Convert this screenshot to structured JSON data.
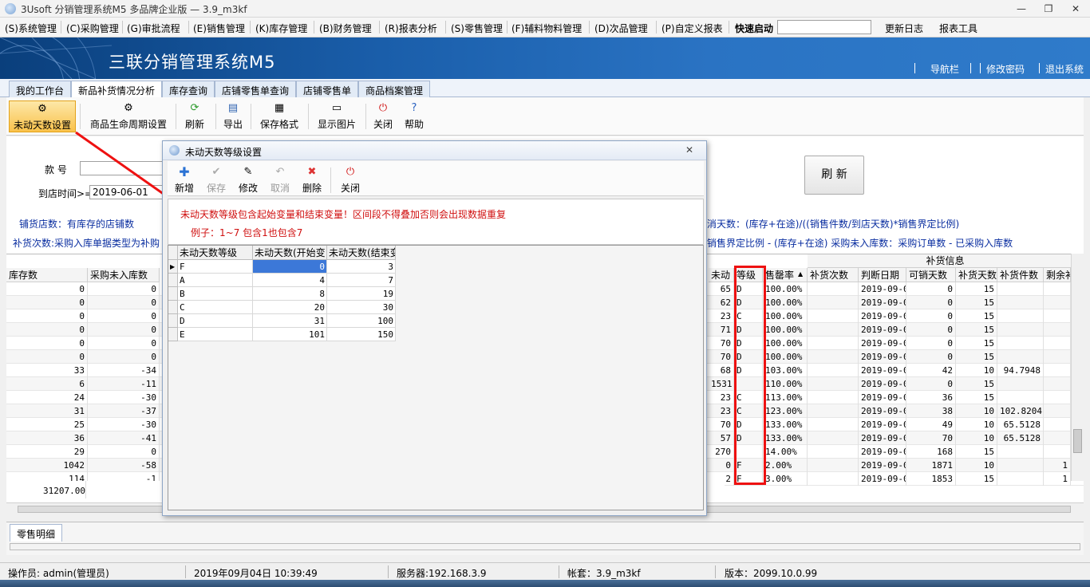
{
  "window": {
    "title": "3Usoft 分销管理系统M5 多品牌企业版 — 3.9_m3kf",
    "min": "—",
    "max": "❐",
    "close": "✕"
  },
  "menu": [
    "(S)系统管理",
    "(C)采购管理",
    "(G)审批流程",
    "(E)销售管理",
    "(K)库存管理",
    "(B)财务管理",
    "(R)报表分析",
    "(S)零售管理",
    "(F)辅料物料管理",
    "(D)次品管理",
    "(P)自定义报表",
    "快速启动",
    "更新日志",
    "报表工具"
  ],
  "banner": {
    "title": "三联分销管理系统M5",
    "links": [
      "导航栏",
      "修改密码",
      "退出系统"
    ]
  },
  "tabs": [
    "我的工作台",
    "新品补货情况分析",
    "库存查询",
    "店铺零售单查询",
    "店铺零售单",
    "商品档案管理"
  ],
  "toolbar": [
    "未动天数设置",
    "商品生命周期设置",
    "刷新",
    "导出",
    "保存格式",
    "显示图片",
    "关闭",
    "帮助"
  ],
  "filter": {
    "style_label": "款  号",
    "arrive_label": "到店时间>=",
    "arrive_value": "2019-06-01",
    "refresh": "刷 新",
    "line1_left": "铺货店数：有库存的店铺数",
    "line1_right": "消天数：(库存+在途)/((销售件数/到店天数)*销售界定比例)",
    "line2_left": "补货次数:采购入库单据类型为补购",
    "line2_right": "销售界定比例 - (库存+在途)  采购未入库数：采购订单数 - 已采购入库数"
  },
  "grid": {
    "group_header": "补货信息",
    "left_headers": [
      "库存数",
      "采购未入库数"
    ],
    "right_headers": [
      "未动",
      "等级",
      "售罄率",
      "补货次数",
      "判断日期",
      "可销天数",
      "补货天数",
      "补货件数",
      "剩余补"
    ],
    "left_rows": [
      [
        "0",
        "0"
      ],
      [
        "0",
        "0"
      ],
      [
        "0",
        "0"
      ],
      [
        "0",
        "0"
      ],
      [
        "0",
        "0"
      ],
      [
        "0",
        "0"
      ],
      [
        "33",
        "-34"
      ],
      [
        "6",
        "-11"
      ],
      [
        "24",
        "-30"
      ],
      [
        "31",
        "-37"
      ],
      [
        "25",
        "-30"
      ],
      [
        "36",
        "-41"
      ],
      [
        "29",
        "0"
      ],
      [
        "1042",
        "-58"
      ],
      [
        "114",
        "-1"
      ]
    ],
    "right_rows": [
      [
        "65",
        "D",
        "100.00%",
        "",
        "2019-09-0",
        "0",
        "15",
        "",
        ""
      ],
      [
        "62",
        "D",
        "100.00%",
        "",
        "2019-09-0",
        "0",
        "15",
        "",
        ""
      ],
      [
        "23",
        "C",
        "100.00%",
        "",
        "2019-09-0",
        "0",
        "15",
        "",
        ""
      ],
      [
        "71",
        "D",
        "100.00%",
        "",
        "2019-09-0",
        "0",
        "15",
        "",
        ""
      ],
      [
        "70",
        "D",
        "100.00%",
        "",
        "2019-09-0",
        "0",
        "15",
        "",
        ""
      ],
      [
        "70",
        "D",
        "100.00%",
        "",
        "2019-09-0",
        "0",
        "15",
        "",
        ""
      ],
      [
        "68",
        "D",
        "103.00%",
        "",
        "2019-09-0",
        "42",
        "10",
        "94.7948",
        ""
      ],
      [
        "1531",
        "",
        "110.00%",
        "",
        "2019-09-0",
        "0",
        "15",
        "",
        ""
      ],
      [
        "23",
        "C",
        "113.00%",
        "",
        "2019-09-0",
        "36",
        "15",
        "",
        ""
      ],
      [
        "23",
        "C",
        "123.00%",
        "",
        "2019-09-0",
        "38",
        "10",
        "102.8204",
        ""
      ],
      [
        "70",
        "D",
        "133.00%",
        "",
        "2019-09-0",
        "49",
        "10",
        "65.5128",
        ""
      ],
      [
        "57",
        "D",
        "133.00%",
        "",
        "2019-09-0",
        "70",
        "10",
        "65.5128",
        ""
      ],
      [
        "270",
        "",
        "14.00%",
        "",
        "2019-09-0",
        "168",
        "15",
        "",
        ""
      ],
      [
        "0",
        "F",
        "2.00%",
        "",
        "2019-09-0",
        "1871",
        "10",
        "",
        "1"
      ],
      [
        "2",
        "F",
        "3.00%",
        "",
        "2019-09-0",
        "1853",
        "15",
        "",
        "1"
      ]
    ],
    "total": "31207.00"
  },
  "bottom_tab": "零售明细",
  "status": [
    "操作员: admin(管理员)",
    "2019年09月04日 10:39:49",
    "服务器:192.168.3.9",
    "帐套：3.9_m3kf",
    "版本：2099.10.0.99"
  ],
  "dialog": {
    "title": "未动天数等级设置",
    "toolbar": [
      "新增",
      "保存",
      "修改",
      "取消",
      "删除",
      "关闭"
    ],
    "note1": "未动天数等级包含起始变量和结束变量！区间段不得叠加否则会出现数据重复",
    "note2": "例子：1~7  包含1也包含7",
    "headers": [
      "未动天数等级",
      "未动天数(开始变",
      "未动天数(结束变"
    ],
    "rows": [
      [
        "F",
        "0",
        "3"
      ],
      [
        "A",
        "4",
        "7"
      ],
      [
        "B",
        "8",
        "19"
      ],
      [
        "C",
        "20",
        "30"
      ],
      [
        "D",
        "31",
        "100"
      ],
      [
        "E",
        "101",
        "150"
      ]
    ]
  },
  "colors": {
    "accent_red": "#d01010",
    "banner_blue": "#1a5eaa",
    "selected_cell": "#3c78d8",
    "toolbar_sel": "#f9c24b"
  }
}
